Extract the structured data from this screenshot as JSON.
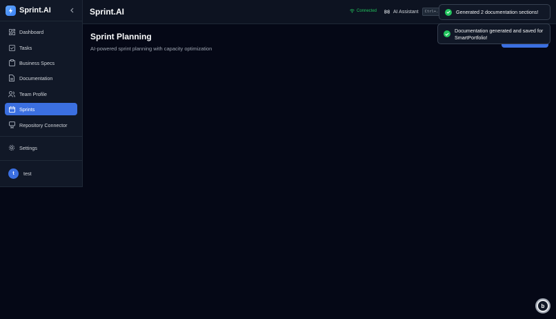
{
  "app": {
    "brand": "Sprint.AI"
  },
  "sidebar": {
    "items": [
      {
        "label": "Dashboard",
        "icon": "dashboard-icon"
      },
      {
        "label": "Tasks",
        "icon": "tasks-icon"
      },
      {
        "label": "Business Specs",
        "icon": "clipboard-icon"
      },
      {
        "label": "Documentation",
        "icon": "document-icon"
      },
      {
        "label": "Team Profile",
        "icon": "team-icon"
      },
      {
        "label": "Sprints",
        "icon": "calendar-icon",
        "active": true
      },
      {
        "label": "Repository Connector",
        "icon": "git-icon"
      }
    ],
    "settings_label": "Settings",
    "user": {
      "initial": "t",
      "name": "test"
    }
  },
  "header": {
    "title": "Sprint.AI",
    "connection_status": "Connected",
    "ai_assistant_label": "AI Assistant",
    "shortcut": "Ctrl+."
  },
  "main": {
    "title": "Sprint Planning",
    "subtitle": "AI-powered sprint planning with capacity optimization"
  },
  "toasts": [
    {
      "message": "Generated 2 documentation sections!"
    },
    {
      "message": "Documentation generated and saved for SmartPortfolio!"
    }
  ],
  "fab": {
    "glyph": "b"
  },
  "colors": {
    "accent": "#3b6fe0",
    "success": "#22c55e",
    "background": "#050816",
    "sidebar": "#111827"
  }
}
